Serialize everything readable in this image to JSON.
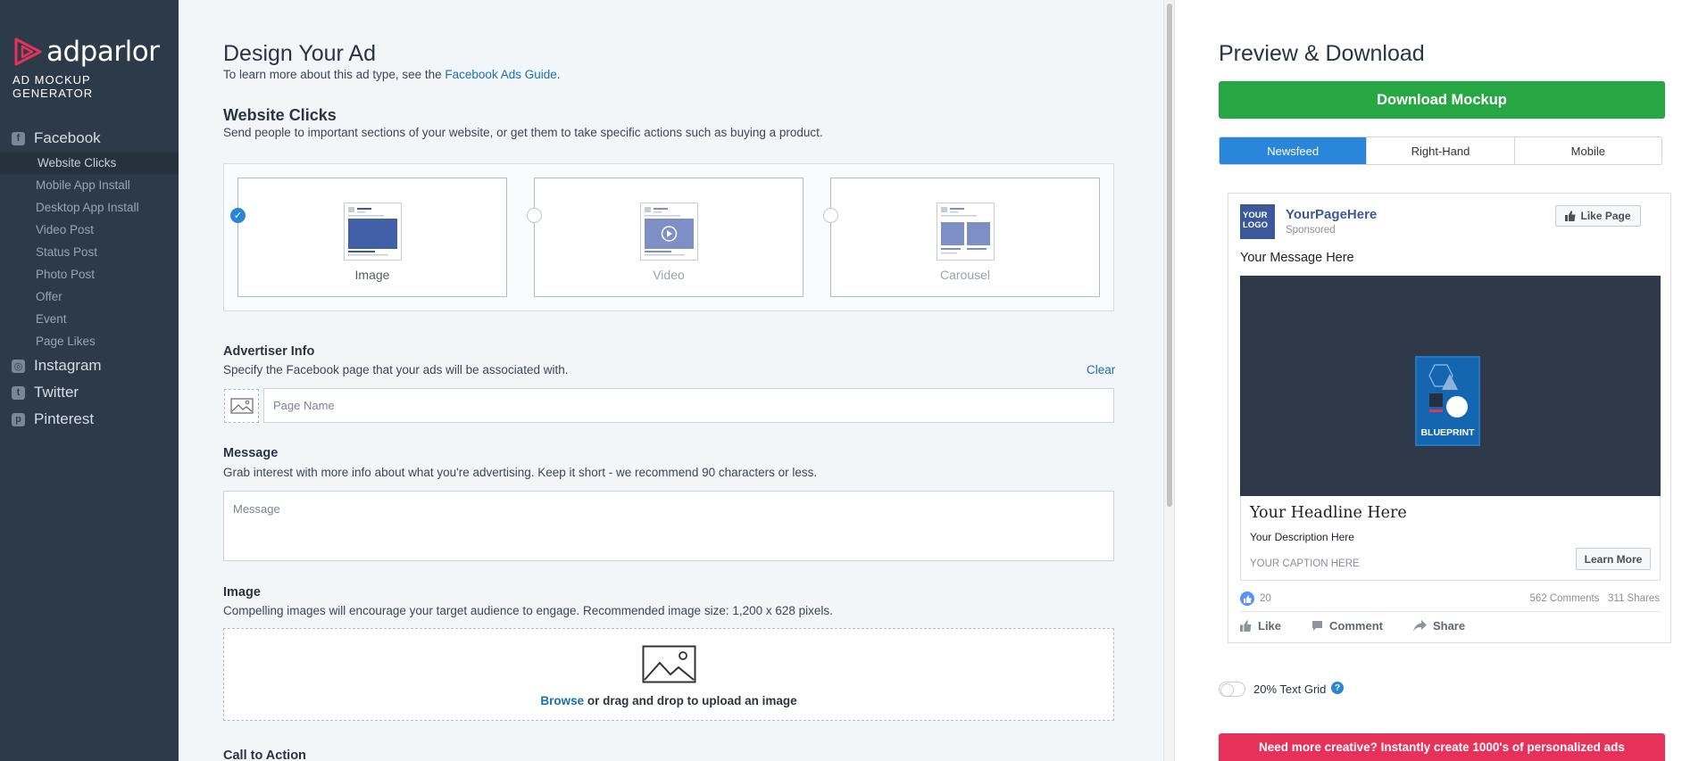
{
  "brand": {
    "name": "adparlor",
    "subtitle": "AD MOCKUP GENERATOR"
  },
  "sidebar": {
    "facebook": "Facebook",
    "facebook_items": [
      "Website Clicks",
      "Mobile App Install",
      "Desktop App Install",
      "Video Post",
      "Status Post",
      "Photo Post",
      "Offer",
      "Event",
      "Page Likes"
    ],
    "instagram": "Instagram",
    "twitter": "Twitter",
    "pinterest": "Pinterest"
  },
  "design": {
    "title": "Design Your Ad",
    "intro": "To learn more about this ad type, see the ",
    "guide_link": "Facebook Ads Guide",
    "intro_end": ".",
    "section_title": "Website Clicks",
    "section_desc": "Send people to important sections of your website, or get them to take specific actions such as buying a product.",
    "types": [
      "Image",
      "Video",
      "Carousel"
    ],
    "advertiser_title": "Advertiser Info",
    "advertiser_desc": "Specify the Facebook page that your ads will be associated with.",
    "clear": "Clear",
    "page_name_placeholder": "Page Name",
    "message_title": "Message",
    "message_desc": "Grab interest with more info about what you're advertising. Keep it short - we recommend 90 characters or less.",
    "message_placeholder": "Message",
    "image_title": "Image",
    "image_desc": "Compelling images will encourage your target audience to engage. Recommended image size: 1,200 x 628 pixels.",
    "browse": "Browse",
    "upload_text": " or drag and drop to upload an image",
    "cta_title": "Call to Action"
  },
  "preview": {
    "title": "Preview & Download",
    "download": "Download Mockup",
    "tabs": [
      "Newsfeed",
      "Right-Hand",
      "Mobile"
    ],
    "logo_text": "YOUR LOGO",
    "page_name": "YourPageHere",
    "sponsored": "Sponsored",
    "like_page": "Like Page",
    "message": "Your Message Here",
    "image_brand": "BLUEPRINT",
    "headline": "Your Headline Here",
    "description": "Your Description Here",
    "caption": "YOUR CAPTION HERE",
    "learn_more": "Learn More",
    "likes": "20",
    "comments": "562 Comments",
    "shares": "311 Shares",
    "actions": [
      "Like",
      "Comment",
      "Share"
    ],
    "text_grid": "20% Text Grid",
    "help": "?",
    "promo": "Need more creative? Instantly create 1000's of personalized ads"
  }
}
